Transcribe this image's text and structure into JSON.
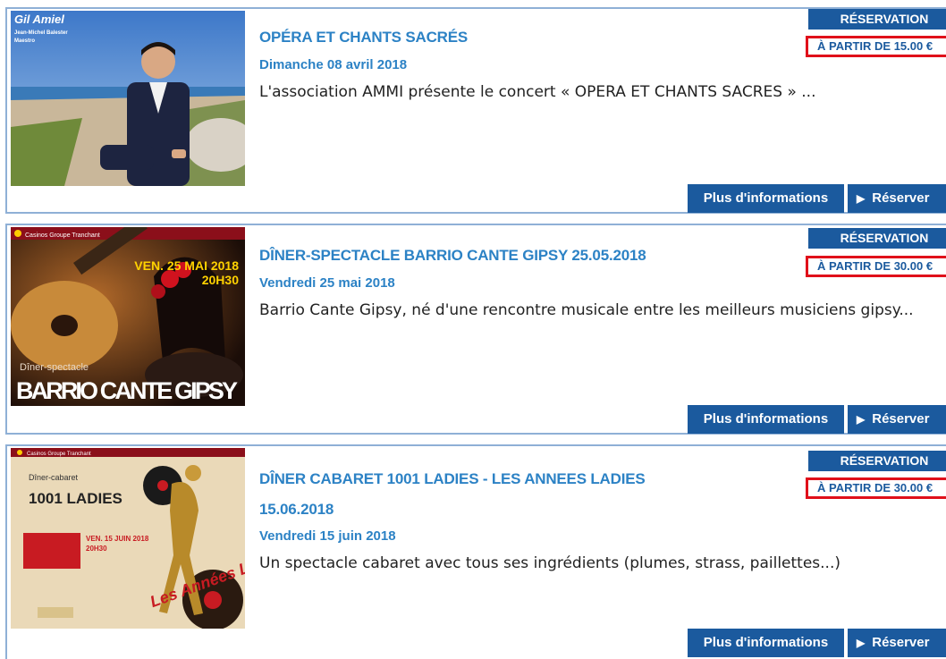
{
  "events": [
    {
      "title": "OPÉRA ET CHANTS SACRÉS",
      "title_line2": "",
      "date": "Dimanche 08 avril 2018",
      "description": "L'association AMMI présente le concert « OPERA ET CHANTS SACRES » ...",
      "reservation_label": "RÉSERVATION",
      "price_label": "À PARTIR DE 15.00 €",
      "more_info_label": "Plus d'informations",
      "reserve_label": "Réserver",
      "image_text": {
        "signature": "Gil Amiel",
        "name": "Jean-Michel Balester",
        "role": "Maestro"
      }
    },
    {
      "title": "DÎNER-SPECTACLE BARRIO CANTE GIPSY 25.05.2018",
      "title_line2": "",
      "date": "Vendredi 25 mai 2018",
      "description": "Barrio Cante Gipsy, né d'une rencontre musicale entre les meilleurs musiciens gipsy...",
      "reservation_label": "RÉSERVATION",
      "price_label": "À PARTIR DE 30.00 €",
      "more_info_label": "Plus d'informations",
      "reserve_label": "Réserver",
      "image_text": {
        "brand": "Casinos Groupe Tranchant",
        "date": "VEN. 25 MAI 2018",
        "time": "20H30",
        "kind": "Dîner-spectacle",
        "headline": "BARRIO CANTE GIPSY"
      }
    },
    {
      "title": "DÎNER CABARET 1001 LADIES - LES ANNEES LADIES",
      "title_line2": "15.06.2018",
      "date": "Vendredi 15 juin 2018",
      "description": "Un spectacle cabaret avec tous ses ingrédients (plumes, strass, paillettes...)",
      "reservation_label": "RÉSERVATION",
      "price_label": "À PARTIR DE 30.00 €",
      "more_info_label": "Plus d'informations",
      "reserve_label": "Réserver",
      "image_text": {
        "brand": "Casinos Groupe Tranchant",
        "kind": "Dîner-cabaret",
        "headline": "1001 LADIES",
        "date": "VEN. 15 JUIN 2018",
        "time": "20H30",
        "script": "Les Années Ladies"
      }
    }
  ],
  "colors": {
    "accent": "#1b5a9e",
    "title": "#2c82c5",
    "highlight": "#e0101a",
    "border": "#8fb0d6"
  }
}
